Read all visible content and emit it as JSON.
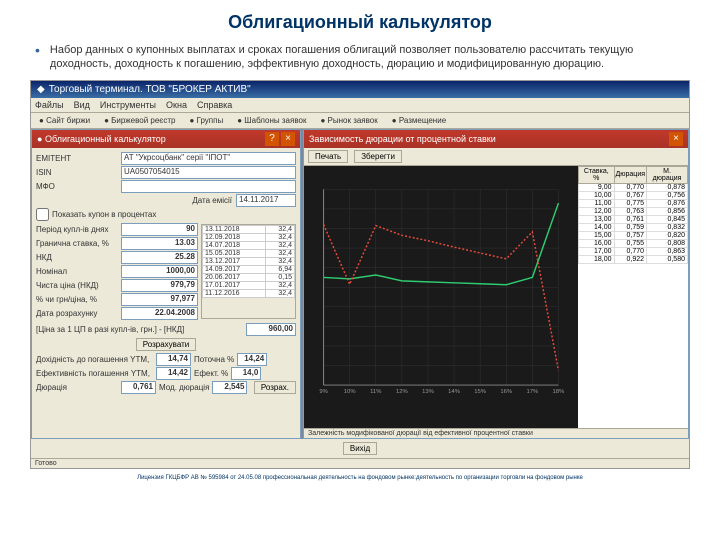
{
  "slide": {
    "title": "Облигационный калькулятор",
    "bullet": "Набор данных о купонных выплатах и сроках погашения облигаций позволяет пользователю рассчитать текущую доходность, доходность к погашению, эффективную доходность, дюрацию и модифицированную дюрацию.",
    "footer": "Лицензия ГКЦБФР АВ № 595984 от 24.05.08 профессиональная деятельность на фондовом рынке:деятельность по организации торговли на фондовом рынке"
  },
  "app": {
    "title": "Торговый терминал. ТОВ \"БРОКЕР АКТИВ\"",
    "menus": [
      "Файлы",
      "Вид",
      "Инструменты",
      "Окна",
      "Справка"
    ],
    "tools": [
      "Сайт биржи",
      "Биржевой реєстр",
      "Группы",
      "Шаблоны заявок",
      "Рынок заявок",
      "Размещение"
    ]
  },
  "calc": {
    "head": "Облигационный калькулятор",
    "emitter": "ЕМІТЕНТ",
    "emitter_val": "АТ \"Укрсоцбанк\" серії \"ІПОТ\"",
    "isin_lbl": "ISIN",
    "isin_val": "UA0507054015",
    "mfo_lbl": "МФО",
    "date_lbl": "Дата емісії",
    "date_val": "14.11.2017",
    "show_chk": "Показать купон в процентах",
    "period_lbl": "Період купл-ів днях",
    "period_val": "90",
    "rate_lbl": "Гранична ставка, %",
    "rate_val": "13.03",
    "nkd_lbl": "НКД",
    "nkd_val": "25.28",
    "nominal_lbl": "Номінал",
    "nominal_val": "1000,00",
    "clean_lbl": "Чиста ціна (НКД)",
    "clean_val": "979,79",
    "dirty_lbl": "% чи грн/ціна, %",
    "dirty_val": "97,977",
    "calc_date_lbl": "Дата розрахунку",
    "calc_date_val": "22.04.2008",
    "formula": "[Ціна за 1 ЦП в разі купл-ів, грн.] - [НКД]",
    "formula_val": "960,00",
    "btn_calc": "Розрахувати",
    "yield_lbl": "Дохідність до погашення YTM,",
    "yield_val": "14,74",
    "cur_lbl": "Поточна %",
    "cur_val": "14,24",
    "eff_lbl": "Ефект. %",
    "eff_val": "14,0",
    "eff2_lbl": "Ефективність погашення YTM,",
    "eff2_val": "14,42",
    "dur_lbl": "Дюрація",
    "dur_val": "0,761",
    "mdur_lbl": "Мод. дюрація",
    "mdur_val": "2,545",
    "btn_close": "Вихід",
    "coupons": [
      [
        "13.11.2018",
        "32,4"
      ],
      [
        "12.09.2018",
        "32,4"
      ],
      [
        "14.07.2018",
        "32,4"
      ],
      [
        "15.05.2018",
        "32,4"
      ],
      [
        "13.12.2017",
        "32,4"
      ],
      [
        "14.09.2017",
        "6,94"
      ],
      [
        "20.06.2017",
        "0,15"
      ],
      [
        "17.01.2017",
        "32,4"
      ],
      [
        "11.12.2016",
        "32,4"
      ]
    ]
  },
  "chart_window": {
    "head": "Зависимость дюрации от процентной ставки",
    "btn_print": "Печать",
    "btn_export": "Зберегти",
    "table_head": [
      "Ставка, %",
      "Дюрация",
      "М. дюрация"
    ],
    "rows": [
      [
        "9,00",
        "0,770",
        "0,878"
      ],
      [
        "10,00",
        "0,767",
        "0,756"
      ],
      [
        "11,00",
        "0,775",
        "0,876"
      ],
      [
        "12,00",
        "0,763",
        "0,856"
      ],
      [
        "13,00",
        "0,761",
        "0,845"
      ],
      [
        "14,00",
        "0,759",
        "0,832"
      ],
      [
        "15,00",
        "0,757",
        "0,820"
      ],
      [
        "16,00",
        "0,755",
        "0,808"
      ],
      [
        "17,00",
        "0,770",
        "0,863"
      ],
      [
        "18,00",
        "0,922",
        "0,580"
      ]
    ]
  },
  "chart_data": {
    "type": "line",
    "title": "Зависимость дюрации от процентной ставки",
    "xlabel": "Ставка, %",
    "ylabel": "",
    "x": [
      9,
      10,
      11,
      12,
      13,
      14,
      15,
      16,
      17,
      18
    ],
    "series": [
      {
        "name": "Дюрация",
        "values": [
          0.77,
          0.767,
          0.775,
          0.763,
          0.761,
          0.759,
          0.757,
          0.755,
          0.77,
          0.922
        ],
        "color": "#2ecc71"
      },
      {
        "name": "М. дюрация",
        "values": [
          0.878,
          0.756,
          0.876,
          0.856,
          0.845,
          0.832,
          0.82,
          0.808,
          0.863,
          0.58
        ],
        "color": "#e74c3c"
      }
    ],
    "xlim": [
      9,
      18
    ],
    "ylim": [
      0.55,
      0.95
    ]
  }
}
